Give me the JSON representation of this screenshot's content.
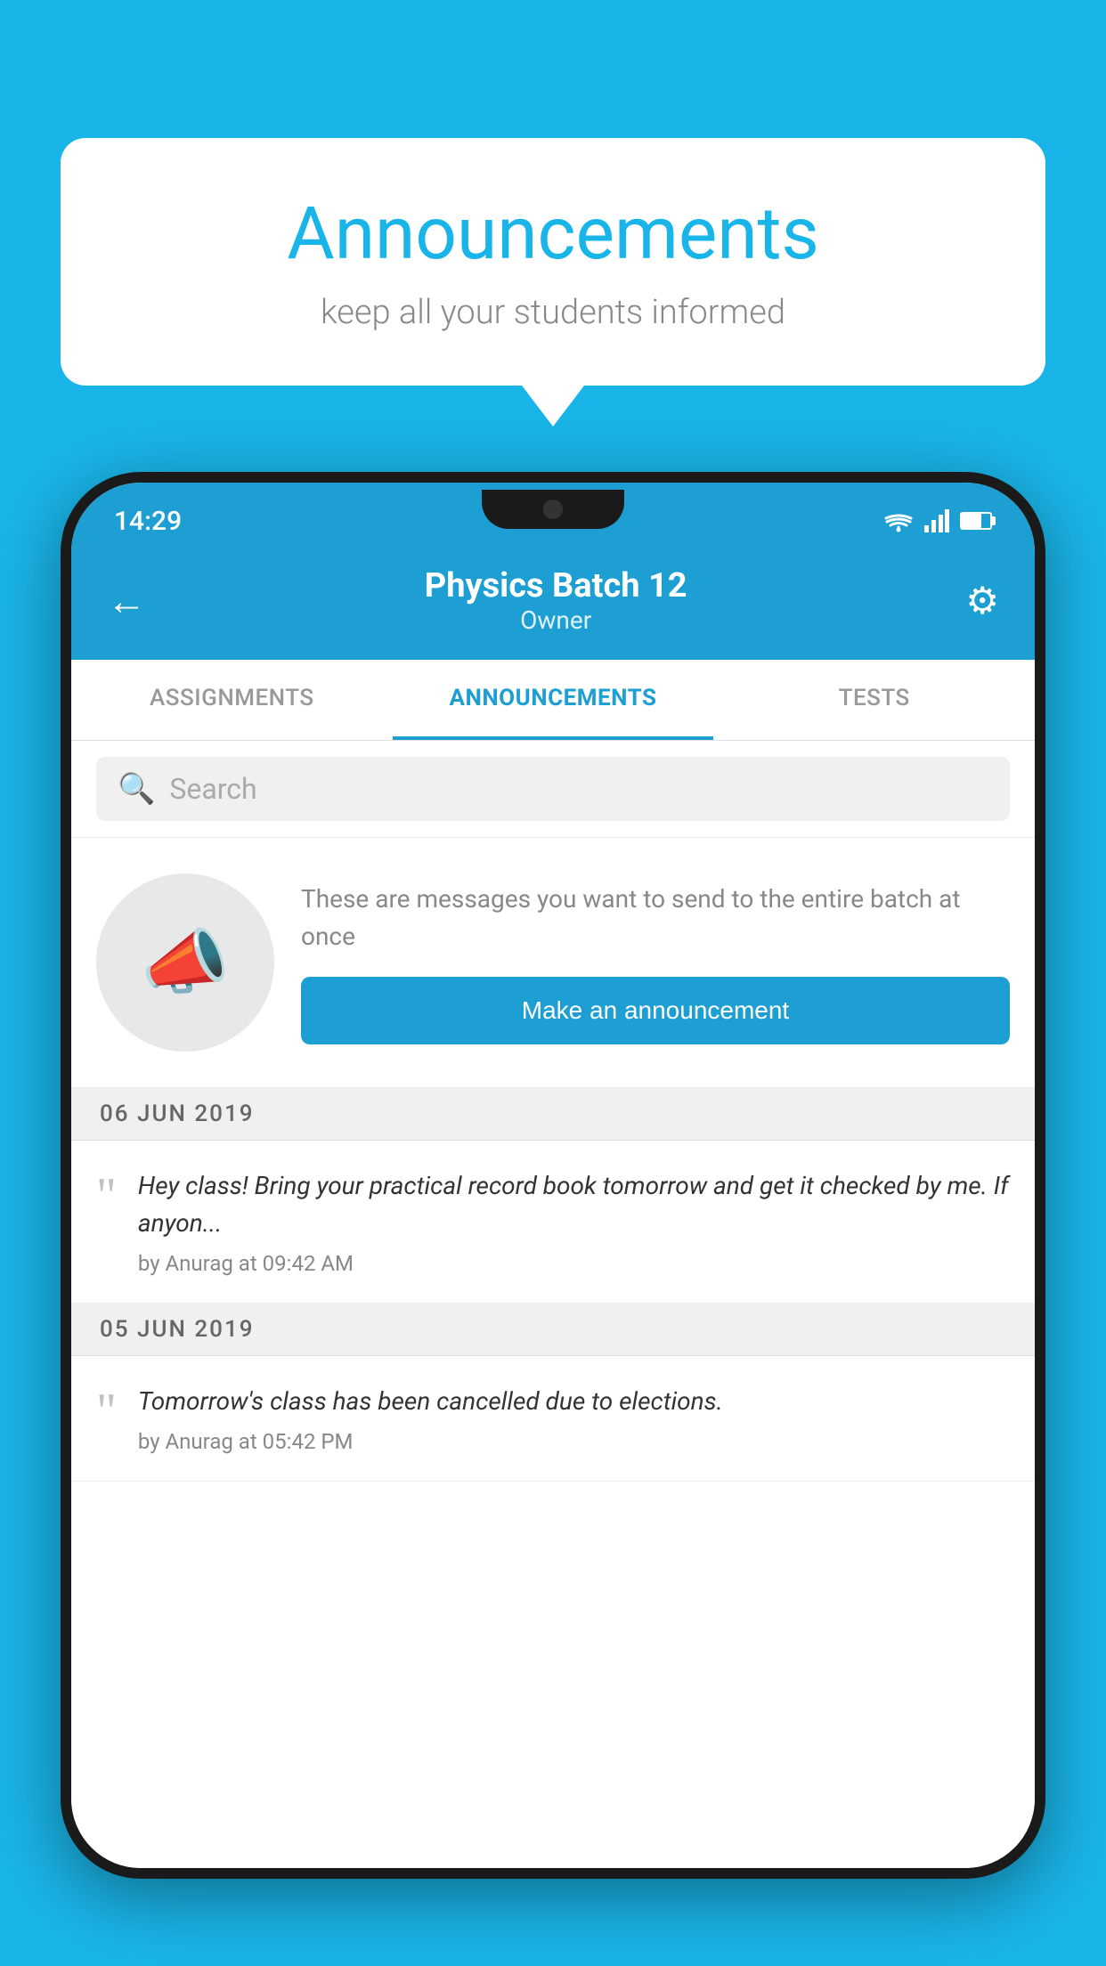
{
  "background_color": "#1ab5e8",
  "speech_bubble": {
    "title": "Announcements",
    "subtitle": "keep all your students informed"
  },
  "phone": {
    "status_bar": {
      "time": "14:29"
    },
    "header": {
      "title": "Physics Batch 12",
      "subtitle": "Owner",
      "back_label": "←",
      "settings_label": "⚙"
    },
    "tabs": [
      {
        "label": "ASSIGNMENTS",
        "active": false
      },
      {
        "label": "ANNOUNCEMENTS",
        "active": true
      },
      {
        "label": "TESTS",
        "active": false
      }
    ],
    "search": {
      "placeholder": "Search"
    },
    "promo": {
      "description": "These are messages you want to send to the entire batch at once",
      "button_label": "Make an announcement"
    },
    "announcements": [
      {
        "date": "06  JUN  2019",
        "text": "Hey class! Bring your practical record book tomorrow and get it checked by me. If anyon...",
        "author": "by Anurag at 09:42 AM"
      },
      {
        "date": "05  JUN  2019",
        "text": "Tomorrow's class has been cancelled due to elections.",
        "author": "by Anurag at 05:42 PM"
      }
    ]
  }
}
